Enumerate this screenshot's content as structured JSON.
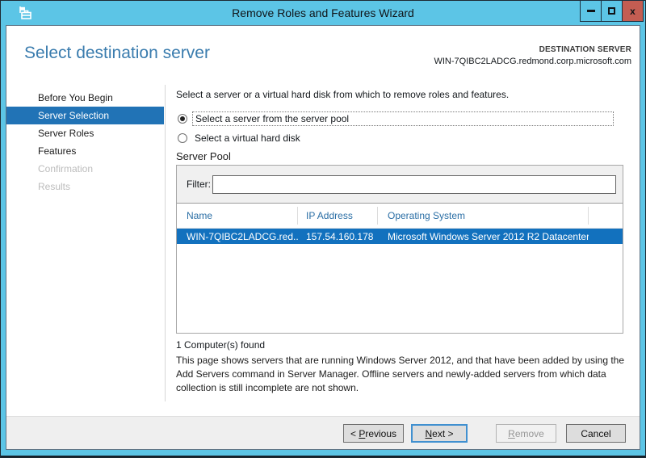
{
  "titlebar": {
    "title": "Remove Roles and Features Wizard",
    "close_glyph": "x"
  },
  "header": {
    "title": "Select destination server",
    "destination_label": "DESTINATION SERVER",
    "destination_server": "WIN-7QIBC2LADCG.redmond.corp.microsoft.com"
  },
  "sidebar": {
    "items": [
      {
        "label": "Before You Begin",
        "state": "enabled"
      },
      {
        "label": "Server Selection",
        "state": "selected"
      },
      {
        "label": "Server Roles",
        "state": "enabled"
      },
      {
        "label": "Features",
        "state": "enabled"
      },
      {
        "label": "Confirmation",
        "state": "disabled"
      },
      {
        "label": "Results",
        "state": "disabled"
      }
    ]
  },
  "main": {
    "intro": "Select a server or a virtual hard disk from which to remove roles and features.",
    "radios": [
      {
        "label": "Select a server from the server pool",
        "selected": true
      },
      {
        "label": "Select a virtual hard disk",
        "selected": false
      }
    ],
    "server_pool": {
      "title": "Server Pool",
      "filter_label": "Filter:",
      "filter_value": "",
      "table": {
        "columns": [
          "Name",
          "IP Address",
          "Operating System"
        ],
        "rows": [
          {
            "name": "WIN-7QIBC2LADCG.red...",
            "ip": "157.54.160.178",
            "os": "Microsoft Windows Server 2012 R2 Datacenter",
            "selected": true
          }
        ]
      },
      "count_text": "1 Computer(s) found"
    },
    "description": "This page shows servers that are running Windows Server 2012, and that have been added by using the Add Servers command in Server Manager. Offline servers and newly-added servers from which data collection is still incomplete are not shown."
  },
  "footer": {
    "previous": {
      "prefix": "< ",
      "mnemonic": "P",
      "rest": "revious"
    },
    "next": {
      "mnemonic": "N",
      "rest": "ext >"
    },
    "remove": {
      "mnemonic": "R",
      "rest": "emove"
    },
    "cancel": {
      "label": "Cancel"
    }
  },
  "colors": {
    "titlebar_blue": "#5cc5e6",
    "sidebar_selection_blue": "#2173b6",
    "row_selection_blue": "#1271be",
    "heading_blue": "#3a7cae",
    "table_header_text_blue": "#2a6ea5",
    "close_button_red": "#c35d52"
  }
}
